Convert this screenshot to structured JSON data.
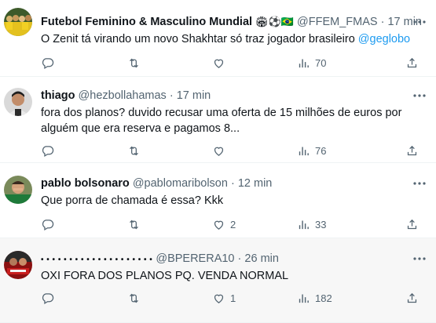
{
  "tweets": [
    {
      "name": "Futebol Feminino & Masculino Mundial",
      "name_emoji": "🏟⚽🇧🇷",
      "handle": "@FFEM_FMAS",
      "dot": "·",
      "time": "17 min",
      "text": "O Zenit tá virando um novo Shakhtar só traz jogador brasileiro ",
      "mention": "@geglobo",
      "replies": "",
      "retweets": "",
      "likes": "",
      "views": "70"
    },
    {
      "name": "thiago",
      "handle": "@hezbollahamas",
      "dot": "·",
      "time": "17 min",
      "text": "fora dos planos? duvido recusar uma oferta de 15 milhões de euros por alguém que era reserva e pagamos 8...",
      "replies": "",
      "retweets": "",
      "likes": "",
      "views": "76"
    },
    {
      "name": "pablo bolsonaro",
      "handle": "@pablomaribolson",
      "dot": "·",
      "time": "12 min",
      "text": "Que porra de chamada é essa? Kkk",
      "replies": "",
      "retweets": "",
      "likes": "2",
      "views": "33"
    },
    {
      "name": "• • • • • • • • • • • • • • • • • • • •",
      "handle": "@BPERERA10",
      "dot": "·",
      "time": "26 min",
      "text": "OXI FORA DOS PLANOS PQ. VENDA NORMAL",
      "replies": "",
      "retweets": "",
      "likes": "1",
      "views": "182"
    }
  ],
  "icons": {
    "reply": "reply-icon",
    "retweet": "retweet-icon",
    "like": "like-icon",
    "views": "views-icon",
    "share": "share-icon",
    "more": "more-icon"
  },
  "colors": {
    "text": "#0f1419",
    "secondary": "#536471",
    "link": "#1d9bf0",
    "divider": "#eff3f4",
    "hover_bg": "#f7f7f7"
  }
}
